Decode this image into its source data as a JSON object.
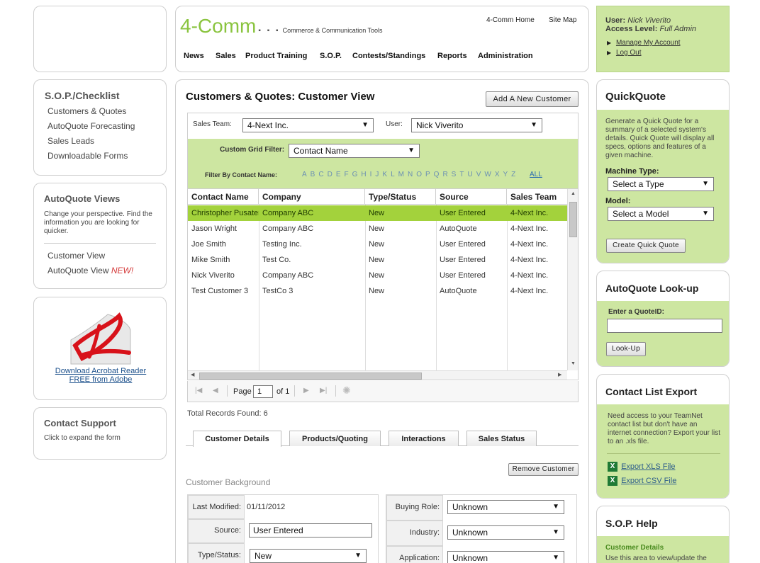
{
  "header": {
    "brand": "4-Comm",
    "tagline": "Commerce & Communication Tools",
    "top_links": [
      "4-Comm Home",
      "Site Map"
    ],
    "nav": [
      "News",
      "Sales",
      "Product Training",
      "S.O.P.",
      "Contests/Standings",
      "Reports",
      "Administration"
    ]
  },
  "user_panel": {
    "user_label": "User:",
    "user_name": "Nick Viverito",
    "access_label": "Access Level:",
    "access_value": "Full Admin",
    "links": [
      "Manage My Account",
      "Log Out"
    ]
  },
  "sidebar": {
    "sop_title": "S.O.P./Checklist",
    "sop_items": [
      "Customers & Quotes",
      "AutoQuote Forecasting",
      "Sales Leads",
      "Downloadable Forms"
    ],
    "aq_title": "AutoQuote Views",
    "aq_desc": "Change your perspective. Find the information you are looking for quicker.",
    "aq_items": [
      "Customer View",
      "AutoQuote View"
    ],
    "aq_new": "NEW!",
    "acrobat_link1": "Download Acrobat Reader",
    "acrobat_link2": "FREE from Adobe",
    "support_title": "Contact Support",
    "support_desc": "Click to expand the form"
  },
  "main": {
    "title": "Customers & Quotes: Customer View",
    "add_button": "Add A New Customer",
    "sales_team_label": "Sales Team:",
    "sales_team_value": "4-Next Inc.",
    "user_label": "User:",
    "user_value": "Nick Viverito",
    "custom_filter_label": "Custom Grid Filter:",
    "custom_filter_value": "Contact Name",
    "filter_by_label": "Filter By Contact Name:",
    "letters": [
      "A",
      "B",
      "C",
      "D",
      "E",
      "F",
      "G",
      "H",
      "I",
      "J",
      "K",
      "L",
      "M",
      "N",
      "O",
      "P",
      "Q",
      "R",
      "S",
      "T",
      "U",
      "V",
      "W",
      "X",
      "Y",
      "Z"
    ],
    "all_label": "ALL",
    "columns": [
      "Contact Name",
      "Company",
      "Type/Status",
      "Source",
      "Sales Team"
    ],
    "rows": [
      [
        "Christopher Pusateri",
        "Company ABC",
        "New",
        "User Entered",
        "4-Next Inc."
      ],
      [
        "Jason Wright",
        "Company ABC",
        "New",
        "AutoQuote",
        "4-Next Inc."
      ],
      [
        "Joe Smith",
        "Testing Inc.",
        "New",
        "User Entered",
        "4-Next Inc."
      ],
      [
        "Mike Smith",
        "Test Co.",
        "New",
        "User Entered",
        "4-Next Inc."
      ],
      [
        "Nick Viverito",
        "Company ABC",
        "New",
        "User Entered",
        "4-Next Inc."
      ],
      [
        "Test Customer 3",
        "TestCo 3",
        "New",
        "AutoQuote",
        "4-Next Inc."
      ]
    ],
    "pager": {
      "page_label": "Page",
      "page_value": "1",
      "of_label": "of 1"
    },
    "total_records": "Total Records Found: 6",
    "tabs": [
      "Customer Details",
      "Products/Quoting",
      "Interactions",
      "Sales Status"
    ],
    "remove_button": "Remove Customer",
    "section_title": "Customer Background",
    "form": {
      "last_modified_label": "Last Modified:",
      "last_modified_value": "01/11/2012",
      "source_label": "Source:",
      "source_value": "User Entered",
      "type_status_label": "Type/Status:",
      "type_status_value": "New",
      "buying_role_label": "Buying Role:",
      "buying_role_value": "Unknown",
      "industry_label": "Industry:",
      "industry_value": "Unknown",
      "application_label": "Application:",
      "application_value": "Unknown"
    }
  },
  "quickquote": {
    "title": "QuickQuote",
    "desc": "Generate a Quick Quote for a summary of a selected system's details. Quick Quote will display all specs, options and features of a given machine.",
    "machine_label": "Machine Type:",
    "machine_value": "Select a Type",
    "model_label": "Model:",
    "model_value": "Select a Model",
    "button": "Create Quick Quote"
  },
  "lookup": {
    "title": "AutoQuote Look-up",
    "label": "Enter a QuoteID:",
    "input_value": "",
    "button": "Look-Up"
  },
  "export": {
    "title": "Contact List Export",
    "desc": "Need access to your TeamNet contact list but don't have an internet connection? Export your list to an .xls file.",
    "links": [
      "Export XLS File",
      "Export CSV File"
    ]
  },
  "soph": {
    "title": "S.O.P. Help",
    "subtitle": "Customer Details",
    "desc": "Use this area to view/update the"
  },
  "colors": {
    "accent_green": "#cde6a1",
    "row_select": "#a3d23c",
    "brand_green": "#8ac43f"
  }
}
